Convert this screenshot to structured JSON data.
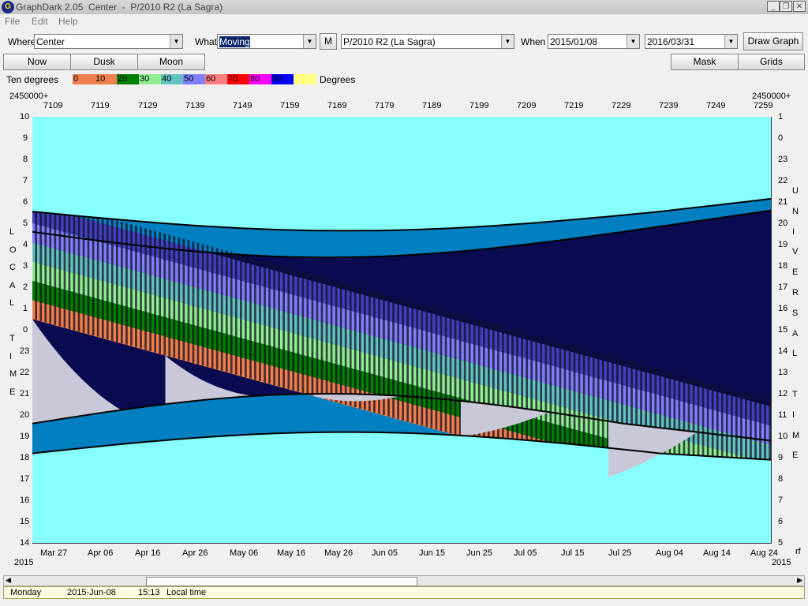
{
  "window": {
    "title": "GraphDark 2.05  Center  -  P/2010 R2 (La Sagra)",
    "app_icon_glyph": "G",
    "min_glyph": "_",
    "restore_glyph": "❐",
    "close_glyph": "✕"
  },
  "menu": {
    "items": [
      "File",
      "Edit",
      "Help"
    ]
  },
  "toolbar": {
    "where_label": "Where",
    "where_value": "Center",
    "what_label": "What",
    "what_value": "Moving",
    "m_button": "M",
    "object_value": "P/2010 R2 (La Sagra)",
    "when_label": "When",
    "start_date": "2015/01/08",
    "end_date": "2016/03/31",
    "draw_button": "Draw Graph"
  },
  "nav_buttons": {
    "now": "Now",
    "dusk": "Dusk",
    "moon": "Moon",
    "mask": "Mask",
    "grids": "Grids"
  },
  "legend": {
    "left_label": "Ten degrees",
    "right_label": "Degrees",
    "swatches": [
      {
        "label": "0",
        "color": "#f08050"
      },
      {
        "label": "10",
        "color": "#f08050"
      },
      {
        "label": "20",
        "color": "#008000"
      },
      {
        "label": "30",
        "color": "#90ee90"
      },
      {
        "label": "40",
        "color": "#66c2c2"
      },
      {
        "label": "50",
        "color": "#8080ff"
      },
      {
        "label": "60",
        "color": "#ff8080"
      },
      {
        "label": "70",
        "color": "#ff0000"
      },
      {
        "label": "80",
        "color": "#ff00ff"
      },
      {
        "label": "90",
        "color": "#0000ff"
      },
      {
        "label": "",
        "color": "#ffff80"
      }
    ]
  },
  "chart_data": {
    "type": "heatmap",
    "jd_prefix_left": "2450000+",
    "jd_prefix_right": "2450000+",
    "jd_ticks": [
      "7109",
      "7119",
      "7129",
      "7139",
      "7149",
      "7159",
      "7169",
      "7179",
      "7189",
      "7199",
      "7209",
      "7219",
      "7229",
      "7239",
      "7249",
      "7259"
    ],
    "date_ticks": [
      "Mar 27",
      "Apr 06",
      "Apr 16",
      "Apr 26",
      "May 06",
      "May 16",
      "May 26",
      "Jun 05",
      "Jun 15",
      "Jun 25",
      "Jul 05",
      "Jul 15",
      "Jul 25",
      "Aug 04",
      "Aug 14",
      "Aug 24"
    ],
    "year_left": "2015",
    "year_right": "2015",
    "corner_right": "rf",
    "local_time_ticks": [
      "10",
      "9",
      "8",
      "7",
      "6",
      "5",
      "4",
      "3",
      "2",
      "1",
      "0",
      "23",
      "22",
      "21",
      "20",
      "19",
      "18",
      "17",
      "16",
      "15",
      "14"
    ],
    "ut_ticks": [
      "1",
      "0",
      "23",
      "22",
      "21",
      "20",
      "19",
      "18",
      "17",
      "16",
      "15",
      "14",
      "13",
      "12",
      "11",
      "10",
      "9",
      "8",
      "7",
      "6",
      "5"
    ],
    "left_axis_label": [
      "L",
      "O",
      "C",
      "A",
      "L",
      "",
      "T",
      "I",
      "M",
      "E"
    ],
    "right_axis_label": [
      "U",
      "N",
      "I",
      "V",
      "E",
      "R",
      "S",
      "A",
      "L",
      "",
      "T",
      "I",
      "M",
      "E"
    ],
    "x_range_jd": [
      7106,
      7262
    ],
    "y_range_local_hours": [
      14,
      34
    ],
    "colors": {
      "daylight": "#88ffff",
      "night": "#0a0a50",
      "twilight": "#0080c0",
      "twilight_light": "#c8c8d8",
      "alt_0_10": "#f08050",
      "alt_20": "#008000",
      "alt_30": "#90ee90",
      "alt_40": "#66c2c2",
      "alt_50": "#8080ff",
      "alt_60": "#4040c0"
    }
  },
  "status": {
    "day": "Monday",
    "date": "2015-Jun-08",
    "time": "15:13",
    "time_label": "Local time"
  }
}
